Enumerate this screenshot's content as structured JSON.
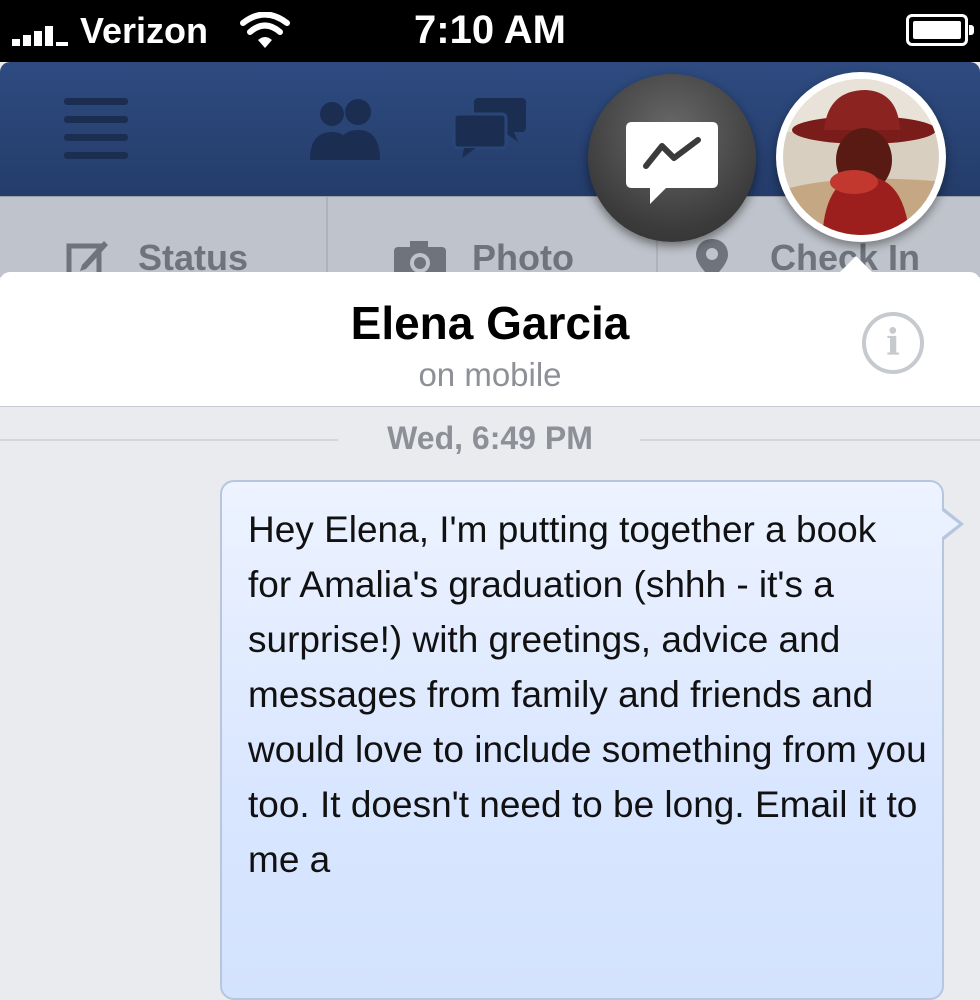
{
  "status_bar": {
    "carrier": "Verizon",
    "time": "7:10 AM"
  },
  "nav": {
    "icons": [
      "menu-icon",
      "friend-requests-icon",
      "messages-icon",
      "messenger-icon"
    ]
  },
  "actions": {
    "status_label": "Status",
    "photo_label": "Photo",
    "checkin_label": "Check In"
  },
  "chat": {
    "contact_name": "Elena Garcia",
    "presence": "on mobile",
    "info_glyph": "i",
    "timestamp": "Wed, 6:49 PM",
    "message": "Hey Elena, I'm putting together a book for Amalia's graduation (shhh - it's a surprise!) with greetings, advice and messages from family and friends and would love to include something from you too. It doesn't need to be long. Email it to me a"
  },
  "colors": {
    "nav_blue": "#2e4b80",
    "bubble_blue": "#d9e6ff",
    "background": "#e9ebee"
  }
}
